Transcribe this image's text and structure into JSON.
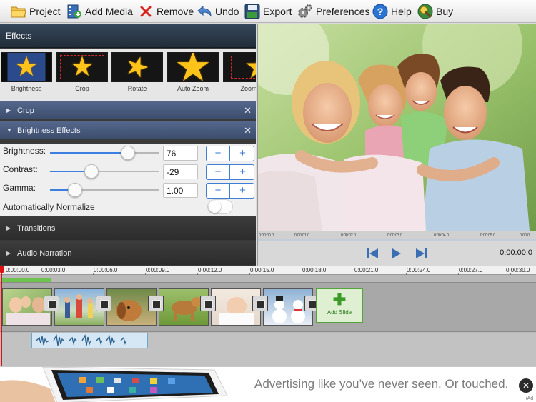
{
  "toolbar": {
    "project": "Project",
    "add_media": "Add Media",
    "remove": "Remove",
    "undo": "Undo",
    "export": "Export",
    "preferences": "Preferences",
    "help": "Help",
    "buy": "Buy",
    "icons": [
      "folder-icon",
      "film-add-icon",
      "remove-x-icon",
      "undo-arrow-icon",
      "export-disk-icon",
      "gears-icon",
      "help-icon",
      "buy-icon"
    ]
  },
  "effects": {
    "title": "Effects",
    "items": [
      {
        "label": "Brightness"
      },
      {
        "label": "Crop"
      },
      {
        "label": "Rotate"
      },
      {
        "label": "Auto Zoom"
      },
      {
        "label": "Zoom"
      }
    ],
    "sections": {
      "crop": "Crop",
      "brightness_effects": "Brightness Effects",
      "transitions": "Transitions",
      "audio_narration": "Audio Narration"
    },
    "close_glyph": "✕",
    "adjustments": [
      {
        "label": "Brightness:",
        "value": "76",
        "level": 0.72
      },
      {
        "label": "Contrast:",
        "value": "-29",
        "level": 0.38
      },
      {
        "label": "Gamma:",
        "value": "1.00",
        "level": 0.23
      }
    ],
    "normalize_label": "Automatically Normalize",
    "normalize_on": false,
    "stepper": {
      "minus": "−",
      "plus": "+"
    }
  },
  "preview": {
    "mini_ruler": [
      "0:00:00.0",
      "0:00:01.0",
      "0:00:02.0",
      "0:00:03.0",
      "0:00:04.0",
      "0:00:05.0",
      "0:00:0"
    ],
    "time": "0:00:00.0"
  },
  "timeline": {
    "ruler": [
      "0:00:00.0",
      "0:00:03.0",
      "0:00:06.0",
      "0:00:09.0",
      "0:00:12.0",
      "0:00:15.0",
      "0:00:18.0",
      "0:00:21.0",
      "0:00:24.0",
      "0:00:27.0",
      "0:00:30.0"
    ],
    "slides": [
      {
        "name": "family-photo"
      },
      {
        "name": "people-walking"
      },
      {
        "name": "puppy-dog"
      },
      {
        "name": "running-dog"
      },
      {
        "name": "baby-photo"
      },
      {
        "name": "snowman"
      }
    ],
    "add_slide": "Add Slide"
  },
  "ad": {
    "text": "Advertising like you’ve never seen. Or touched.",
    "close": "✕",
    "tag": "iAd"
  },
  "colors": {
    "accent": "#3f7fd6",
    "section_blue": "#4a5d80",
    "add_slide_green": "#55a33b",
    "playhead_red": "#e01010"
  }
}
